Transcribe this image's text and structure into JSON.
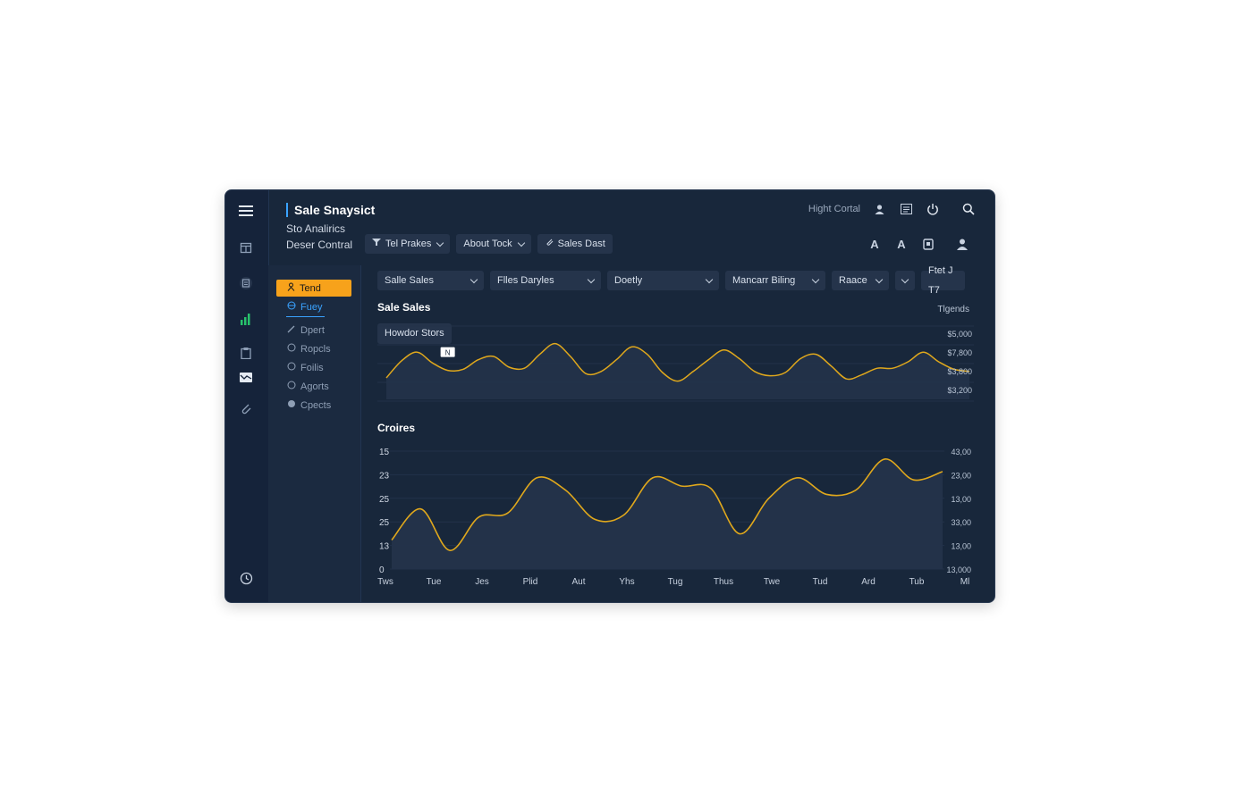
{
  "app": {
    "title": "Sale Snaysict",
    "subtitle1": "Sto Analirics",
    "subtitle2": "Deser Contral"
  },
  "header": {
    "high_contrast_label": "Hight Cortal",
    "buttons": [
      {
        "label": "Tel Prakes",
        "icon": "filter-icon"
      },
      {
        "label": "About Tock",
        "icon": ""
      },
      {
        "label": "Sales Dast",
        "icon": "link-icon"
      }
    ],
    "right_icons": [
      "user-icon",
      "list-icon",
      "power-icon",
      "search-icon"
    ],
    "text_icons": [
      "A",
      "A"
    ]
  },
  "rail_icons": [
    "menu-icon",
    "box-icon",
    "document-icon",
    "bar-chart-icon",
    "clipboard-icon",
    "mail-icon",
    "paperclip-icon",
    "clock-icon"
  ],
  "nav": {
    "items": [
      {
        "label": "Tend",
        "state": "active"
      },
      {
        "label": "Fuey",
        "state": "selected"
      },
      {
        "label": "Dpert",
        "state": ""
      },
      {
        "label": "Ropcls",
        "state": ""
      },
      {
        "label": "Foilis",
        "state": ""
      },
      {
        "label": "Agorts",
        "state": ""
      },
      {
        "label": "Cpects",
        "state": ""
      }
    ]
  },
  "filters": [
    {
      "label": "Salle Sales"
    },
    {
      "label": "Flles Daryles"
    },
    {
      "label": "Doetly"
    },
    {
      "label": "Mancarr Biling"
    },
    {
      "label": "Raace"
    },
    {
      "label": ""
    },
    {
      "label": "Ftet J T7"
    }
  ],
  "colors": {
    "accent": "#f7a21b",
    "line": "#e0a81c",
    "link": "#3aa3ff",
    "bg": "#18273b"
  },
  "chart_data": [
    {
      "type": "area",
      "title": "Sale Sales",
      "chip": "Howdor Stors",
      "marker_label": "N",
      "legend": "Tlgends",
      "right_ticks": [
        "$5,000",
        "$7,800",
        "$3,800",
        "$3,200"
      ],
      "x": [
        0,
        1,
        2,
        3,
        4,
        5,
        6,
        7,
        8,
        9,
        10,
        11,
        12,
        13,
        14,
        15,
        16,
        17,
        18,
        19,
        20,
        21,
        22,
        23,
        24,
        25,
        26,
        27,
        28,
        29,
        30,
        31,
        32,
        33,
        34,
        35,
        36,
        37,
        38
      ],
      "values": [
        2.0,
        3.6,
        4.4,
        3.4,
        2.7,
        2.8,
        3.7,
        4.0,
        3.0,
        2.9,
        4.2,
        5.2,
        4.0,
        2.4,
        2.6,
        3.7,
        4.9,
        4.2,
        2.5,
        1.7,
        2.6,
        3.7,
        4.6,
        3.8,
        2.6,
        2.2,
        2.5,
        3.8,
        4.2,
        3.1,
        1.9,
        2.3,
        2.9,
        2.9,
        3.5,
        4.4,
        3.5,
        2.8,
        2.6
      ]
    },
    {
      "type": "area",
      "title": "Croires",
      "left_ticks": [
        "15",
        "23",
        "25",
        "25",
        "13",
        "0"
      ],
      "right_ticks": [
        "43,00",
        "23,00",
        "13,00",
        "33,00",
        "13,00",
        "13,000"
      ],
      "categories": [
        "Tws",
        "Tue",
        "Jes",
        "Plid",
        "Aut",
        "Yhs",
        "Tug",
        "Thus",
        "Twe",
        "Tud",
        "Ard",
        "Tub",
        "Ml"
      ],
      "values": [
        1.4,
        2.9,
        0.9,
        2.5,
        2.7,
        4.4,
        3.8,
        2.4,
        2.6,
        4.4,
        4.0,
        3.9,
        1.7,
        3.4,
        4.4,
        3.6,
        3.8,
        5.3,
        4.3,
        4.7
      ]
    }
  ]
}
